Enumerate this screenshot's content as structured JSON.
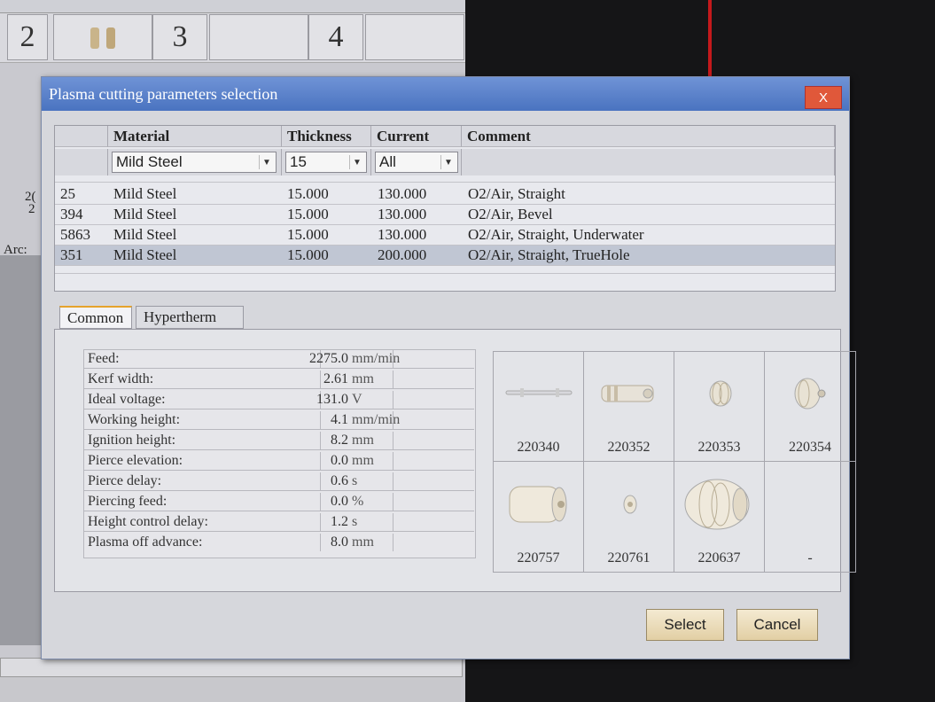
{
  "background": {
    "cells": [
      "2",
      "3",
      "4"
    ],
    "labels": [
      "2(",
      "2",
      "Arc:"
    ]
  },
  "dialog": {
    "title": "Plasma cutting parameters selection",
    "close_label": "X",
    "grid": {
      "headers": [
        "",
        "Material",
        "Thickness",
        "Current",
        "Comment"
      ],
      "filters": {
        "material": "Mild Steel",
        "thickness": "15",
        "current": "All"
      },
      "rows": [
        {
          "id": "25",
          "material": "Mild Steel",
          "thickness": "15.000",
          "current": "130.000",
          "comment": "O2/Air, Straight"
        },
        {
          "id": "394",
          "material": "Mild Steel",
          "thickness": "15.000",
          "current": "130.000",
          "comment": "O2/Air, Bevel"
        },
        {
          "id": "5863",
          "material": "Mild Steel",
          "thickness": "15.000",
          "current": "130.000",
          "comment": "O2/Air, Straight, Underwater"
        },
        {
          "id": "351",
          "material": "Mild Steel",
          "thickness": "15.000",
          "current": "200.000",
          "comment": "O2/Air, Straight, TrueHole"
        }
      ]
    },
    "tabs": [
      "Common",
      "Hypertherm"
    ],
    "params": [
      {
        "label": "Feed:",
        "value": "2275.0",
        "unit": "mm/min"
      },
      {
        "label": "Kerf width:",
        "value": "2.61",
        "unit": "mm"
      },
      {
        "label": "Ideal voltage:",
        "value": "131.0",
        "unit": "V"
      },
      {
        "label": "Working height:",
        "value": "4.1",
        "unit": "mm/min"
      },
      {
        "label": "Ignition height:",
        "value": "8.2",
        "unit": "mm"
      },
      {
        "label": "Pierce elevation:",
        "value": "0.0",
        "unit": "mm"
      },
      {
        "label": "Pierce delay:",
        "value": "0.6",
        "unit": "s"
      },
      {
        "label": "Piercing feed:",
        "value": "0.0",
        "unit": "%"
      },
      {
        "label": "Height control delay:",
        "value": "1.2",
        "unit": "s"
      },
      {
        "label": "Plasma off advance:",
        "value": "8.0",
        "unit": "mm"
      }
    ],
    "parts": [
      "220340",
      "220352",
      "220353",
      "220354",
      "220757",
      "220761",
      "220637",
      "-"
    ],
    "buttons": {
      "select": "Select",
      "cancel": "Cancel"
    }
  }
}
